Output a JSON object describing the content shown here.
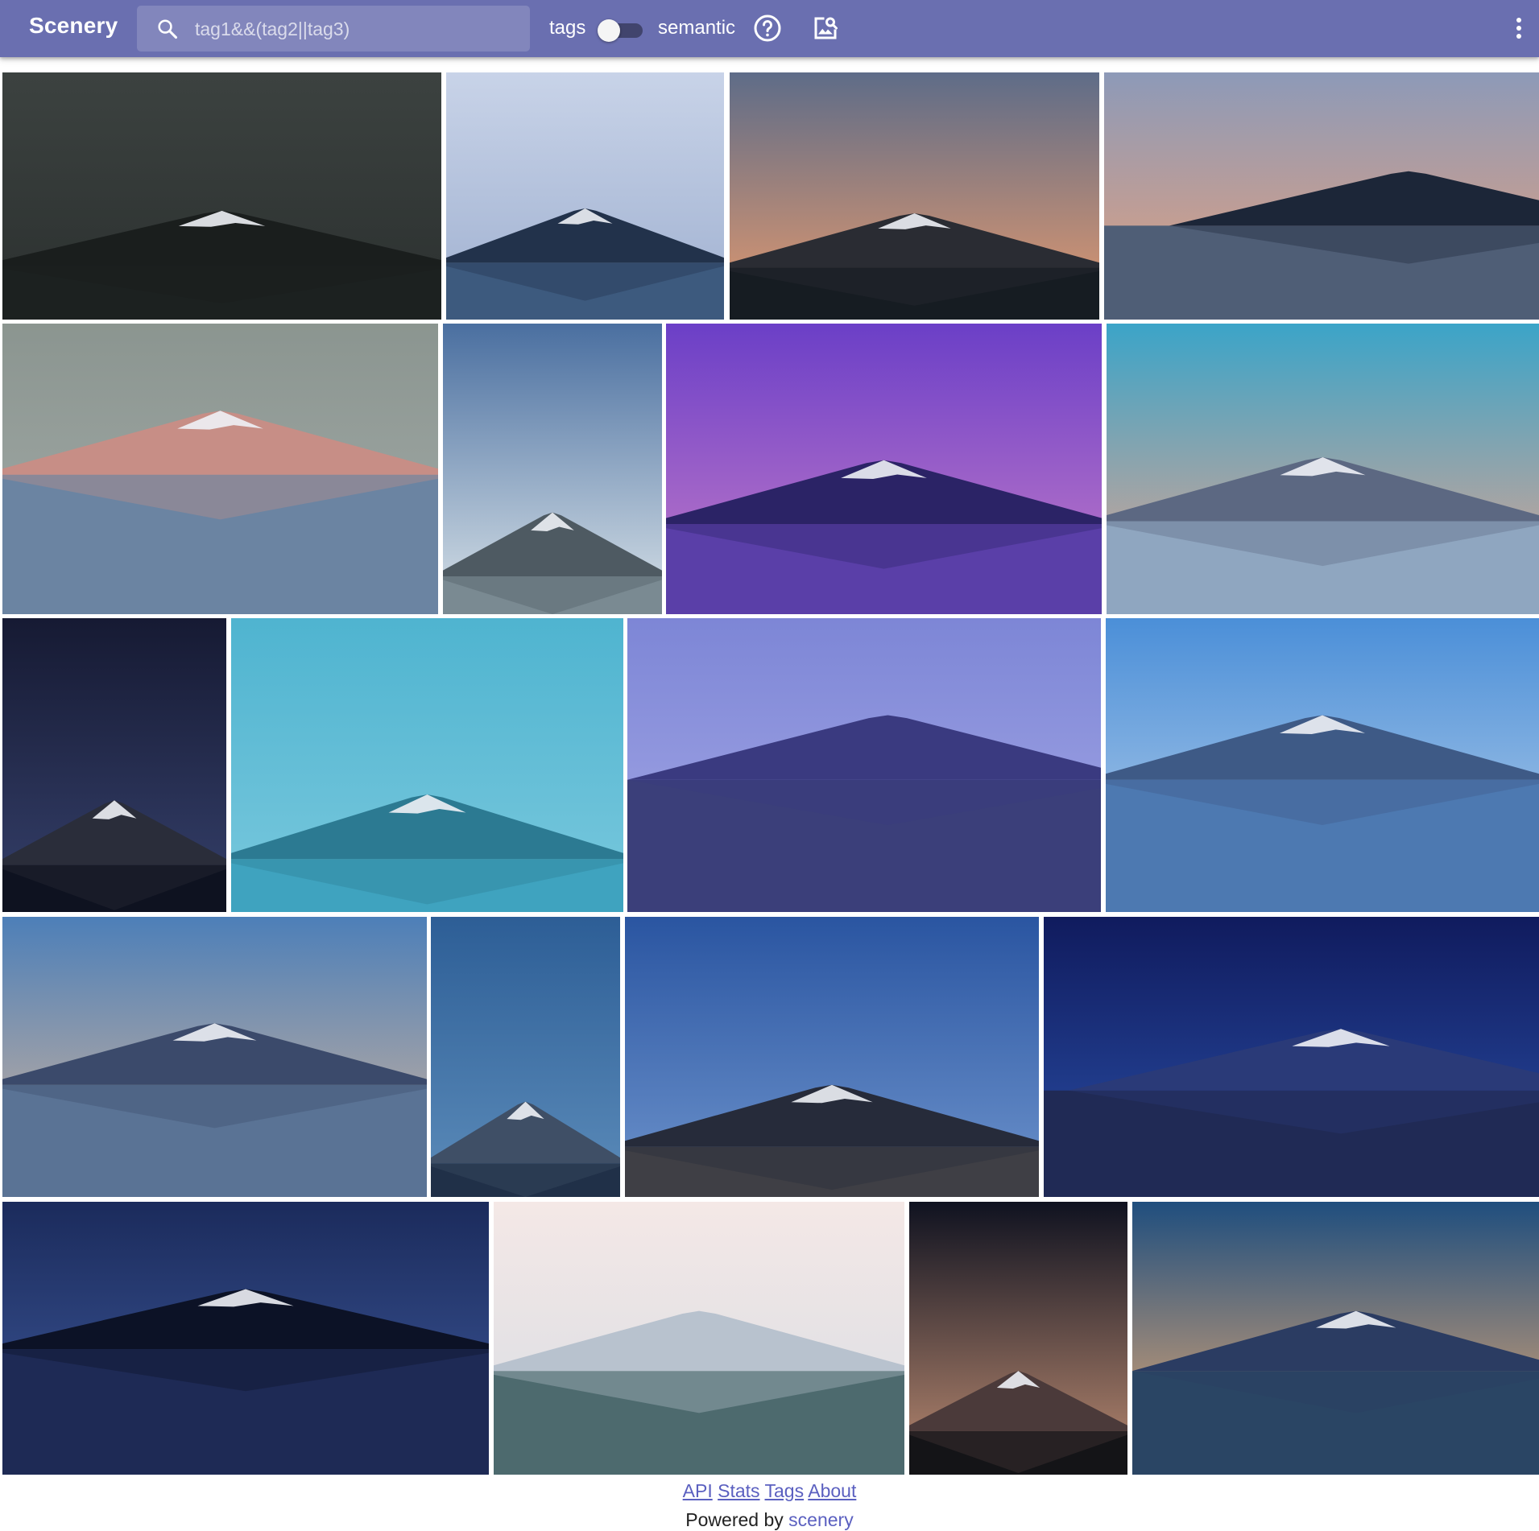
{
  "header": {
    "brand": "Scenery",
    "search_placeholder": "tag1&&(tag2||tag3)",
    "tags_label": "tags",
    "semantic_label": "semantic",
    "tags_toggle_on": false,
    "accent_color": "#6a6fb0"
  },
  "gallery": {
    "image_count": 20
  },
  "footer": {
    "links": [
      "API",
      "Stats",
      "Tags",
      "About"
    ],
    "powered_prefix": "Powered by",
    "powered_link": "scenery",
    "link_color": "#5b60c0"
  }
}
